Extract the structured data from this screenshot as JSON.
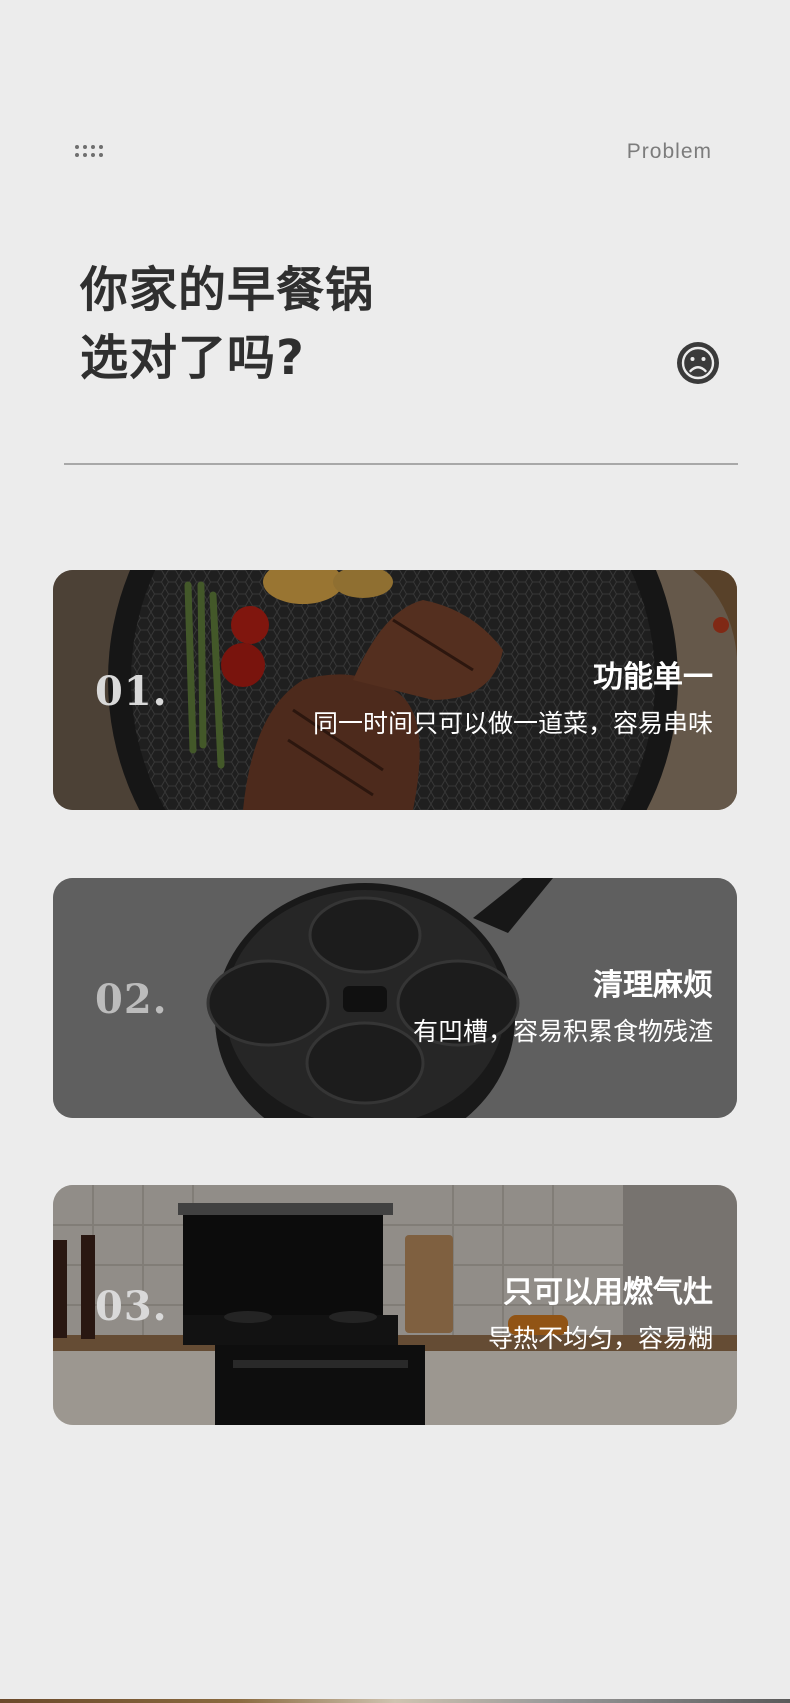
{
  "header": {
    "menu_icon": "grid-dots-icon",
    "section_label": "Problem"
  },
  "title": {
    "line1": "你家的早餐锅",
    "line2": "选对了吗?",
    "emoji_icon": "sad-face-icon"
  },
  "problems": [
    {
      "number": "01.",
      "title": "功能单一",
      "description": "同一时间只可以做一道菜，容易串味",
      "image": "steak-frying-pan-photo"
    },
    {
      "number": "02.",
      "title": "清理麻烦",
      "description": "有凹槽，容易积累食物残渣",
      "image": "four-hole-egg-pan-photo"
    },
    {
      "number": "03.",
      "title": "只可以用燃气灶",
      "description": "导热不均匀，容易糊",
      "image": "kitchen-gas-stove-photo"
    }
  ],
  "colors": {
    "background": "#ececec",
    "title_text": "#2f2f2f",
    "label_text": "#7c7c7c",
    "card_text": "#ffffff"
  }
}
